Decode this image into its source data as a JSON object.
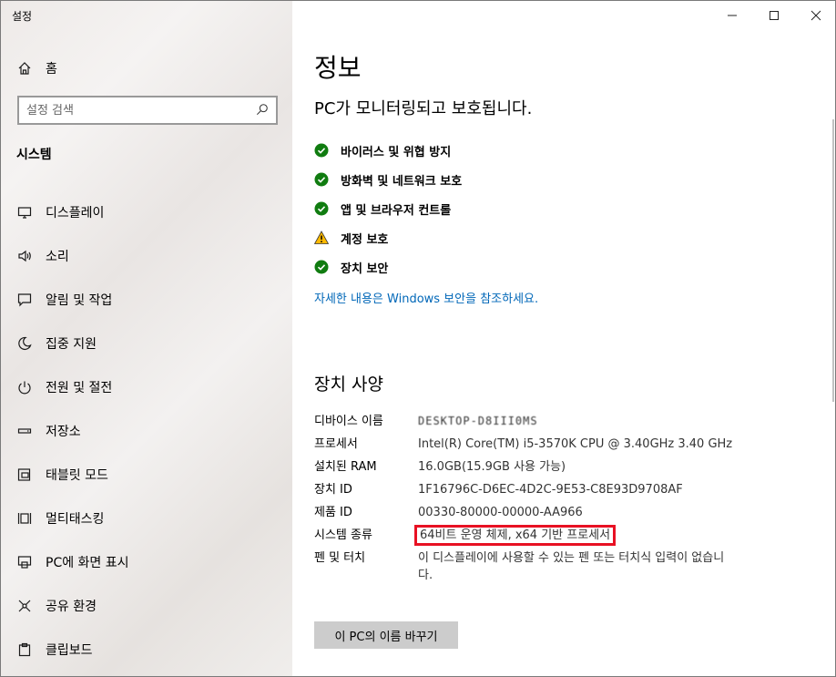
{
  "window": {
    "title": "설정"
  },
  "sidebar": {
    "home_label": "홈",
    "search_placeholder": "설정 검색",
    "section_heading": "시스템",
    "items": [
      {
        "label": "디스플레이",
        "icon": "monitor-icon"
      },
      {
        "label": "소리",
        "icon": "speaker-icon"
      },
      {
        "label": "알림 및 작업",
        "icon": "notification-icon"
      },
      {
        "label": "집중 지원",
        "icon": "moon-icon"
      },
      {
        "label": "전원 및 절전",
        "icon": "power-icon"
      },
      {
        "label": "저장소",
        "icon": "storage-icon"
      },
      {
        "label": "태블릿 모드",
        "icon": "tablet-icon"
      },
      {
        "label": "멀티태스킹",
        "icon": "multitask-icon"
      },
      {
        "label": "PC에 화면 표시",
        "icon": "project-icon"
      },
      {
        "label": "공유 환경",
        "icon": "share-icon"
      },
      {
        "label": "클립보드",
        "icon": "clipboard-icon"
      }
    ]
  },
  "main": {
    "page_title": "정보",
    "protection_title": "PC가 모니터링되고 보호됩니다.",
    "status_items": [
      {
        "label": "바이러스 및 위협 방지",
        "status": "ok"
      },
      {
        "label": "방화벽 및 네트워크 보호",
        "status": "ok"
      },
      {
        "label": "앱 및 브라우저 컨트롤",
        "status": "ok"
      },
      {
        "label": "계정 보호",
        "status": "warning"
      },
      {
        "label": "장치 보안",
        "status": "ok"
      }
    ],
    "security_link": "자세한 내용은 Windows 보안을 참조하세요.",
    "spec_title": "장치 사양",
    "specs": [
      {
        "label": "디바이스 이름",
        "value": "DESKTOP-D8III0MS"
      },
      {
        "label": "프로세서",
        "value": "Intel(R) Core(TM) i5-3570K CPU @ 3.40GHz   3.40 GHz"
      },
      {
        "label": "설치된 RAM",
        "value": "16.0GB(15.9GB 사용 가능)"
      },
      {
        "label": "장치 ID",
        "value": "1F16796C-D6EC-4D2C-9E53-C8E93D9708AF"
      },
      {
        "label": "제품 ID",
        "value": "00330-80000-00000-AA966"
      },
      {
        "label": "시스템 종류",
        "value": "64비트 운영 체제, x64 기반 프로세서"
      },
      {
        "label": "펜 및 터치",
        "value": "이 디스플레이에 사용할 수 있는 펜 또는 터치식 입력이 없습니다."
      }
    ],
    "rename_button": "이 PC의 이름 바꾸기"
  },
  "colors": {
    "accent": "#0067b8",
    "ok": "#107c10",
    "warning": "#ffb900",
    "highlight": "#e81123"
  }
}
